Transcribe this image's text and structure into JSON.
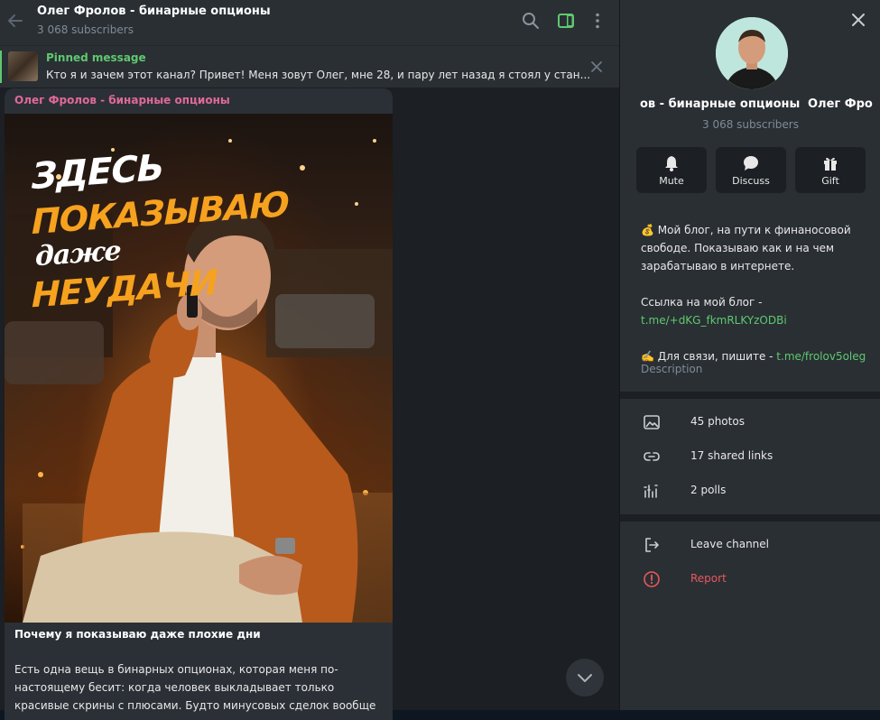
{
  "header": {
    "title": "Олег Фролов - бинарные опционы",
    "subscribers": "3 068 subscribers"
  },
  "pinned": {
    "title": "Pinned message",
    "text": "Кто я и зачем этот канал?  Привет!  Меня зовут Олег, мне 28, и пару лет назад я стоял у стан..."
  },
  "message": {
    "author": "Олег Фролов - бинарные опционы",
    "photo_text": {
      "line1": "ЗДЕСЬ",
      "line2": "ПОКАЗЫВАЮ",
      "line3": "даже",
      "line4": "НЕУДАЧИ"
    },
    "caption_title": "Почему я показываю даже плохие дни",
    "caption_text": "Есть одна вещь в бинарных опционах, которая меня по-настоящему бесит: когда человек выкладывает только красивые скрины с плюсами. Будто минусовых сделок вообще не"
  },
  "panel": {
    "name_scroll": "ов - бинарные опционы",
    "name_scroll_next": "Олег Фро",
    "subscribers": "3 068 subscribers",
    "actions": [
      {
        "label": "Mute",
        "icon": "bell-icon"
      },
      {
        "label": "Discuss",
        "icon": "chat-bubble-icon"
      },
      {
        "label": "Gift",
        "icon": "gift-icon"
      }
    ],
    "description": {
      "line1": "💰 Мой блог, на пути к финаносовой свободе. Показываю как и на чем зарабатываю в интернете.",
      "line2": "Ссылка на мой блог -",
      "link1": "t.me/+dKG_fkmRLKYzODBi",
      "line3": "✍️ Для связи, пишите - ",
      "link2": "t.me/frolov5oleg",
      "label": "Description"
    },
    "media": [
      {
        "label": "45 photos",
        "icon": "photo-icon"
      },
      {
        "label": "17 shared links",
        "icon": "link-icon"
      },
      {
        "label": "2 polls",
        "icon": "poll-icon"
      }
    ],
    "leave": "Leave channel",
    "report": "Report"
  },
  "colors": {
    "accent_green": "#5ec96f",
    "author_pink": "#e0689a",
    "danger_red": "#e8585c",
    "panel_bg": "#2a2f34",
    "chat_bg": "#1c1f23"
  }
}
